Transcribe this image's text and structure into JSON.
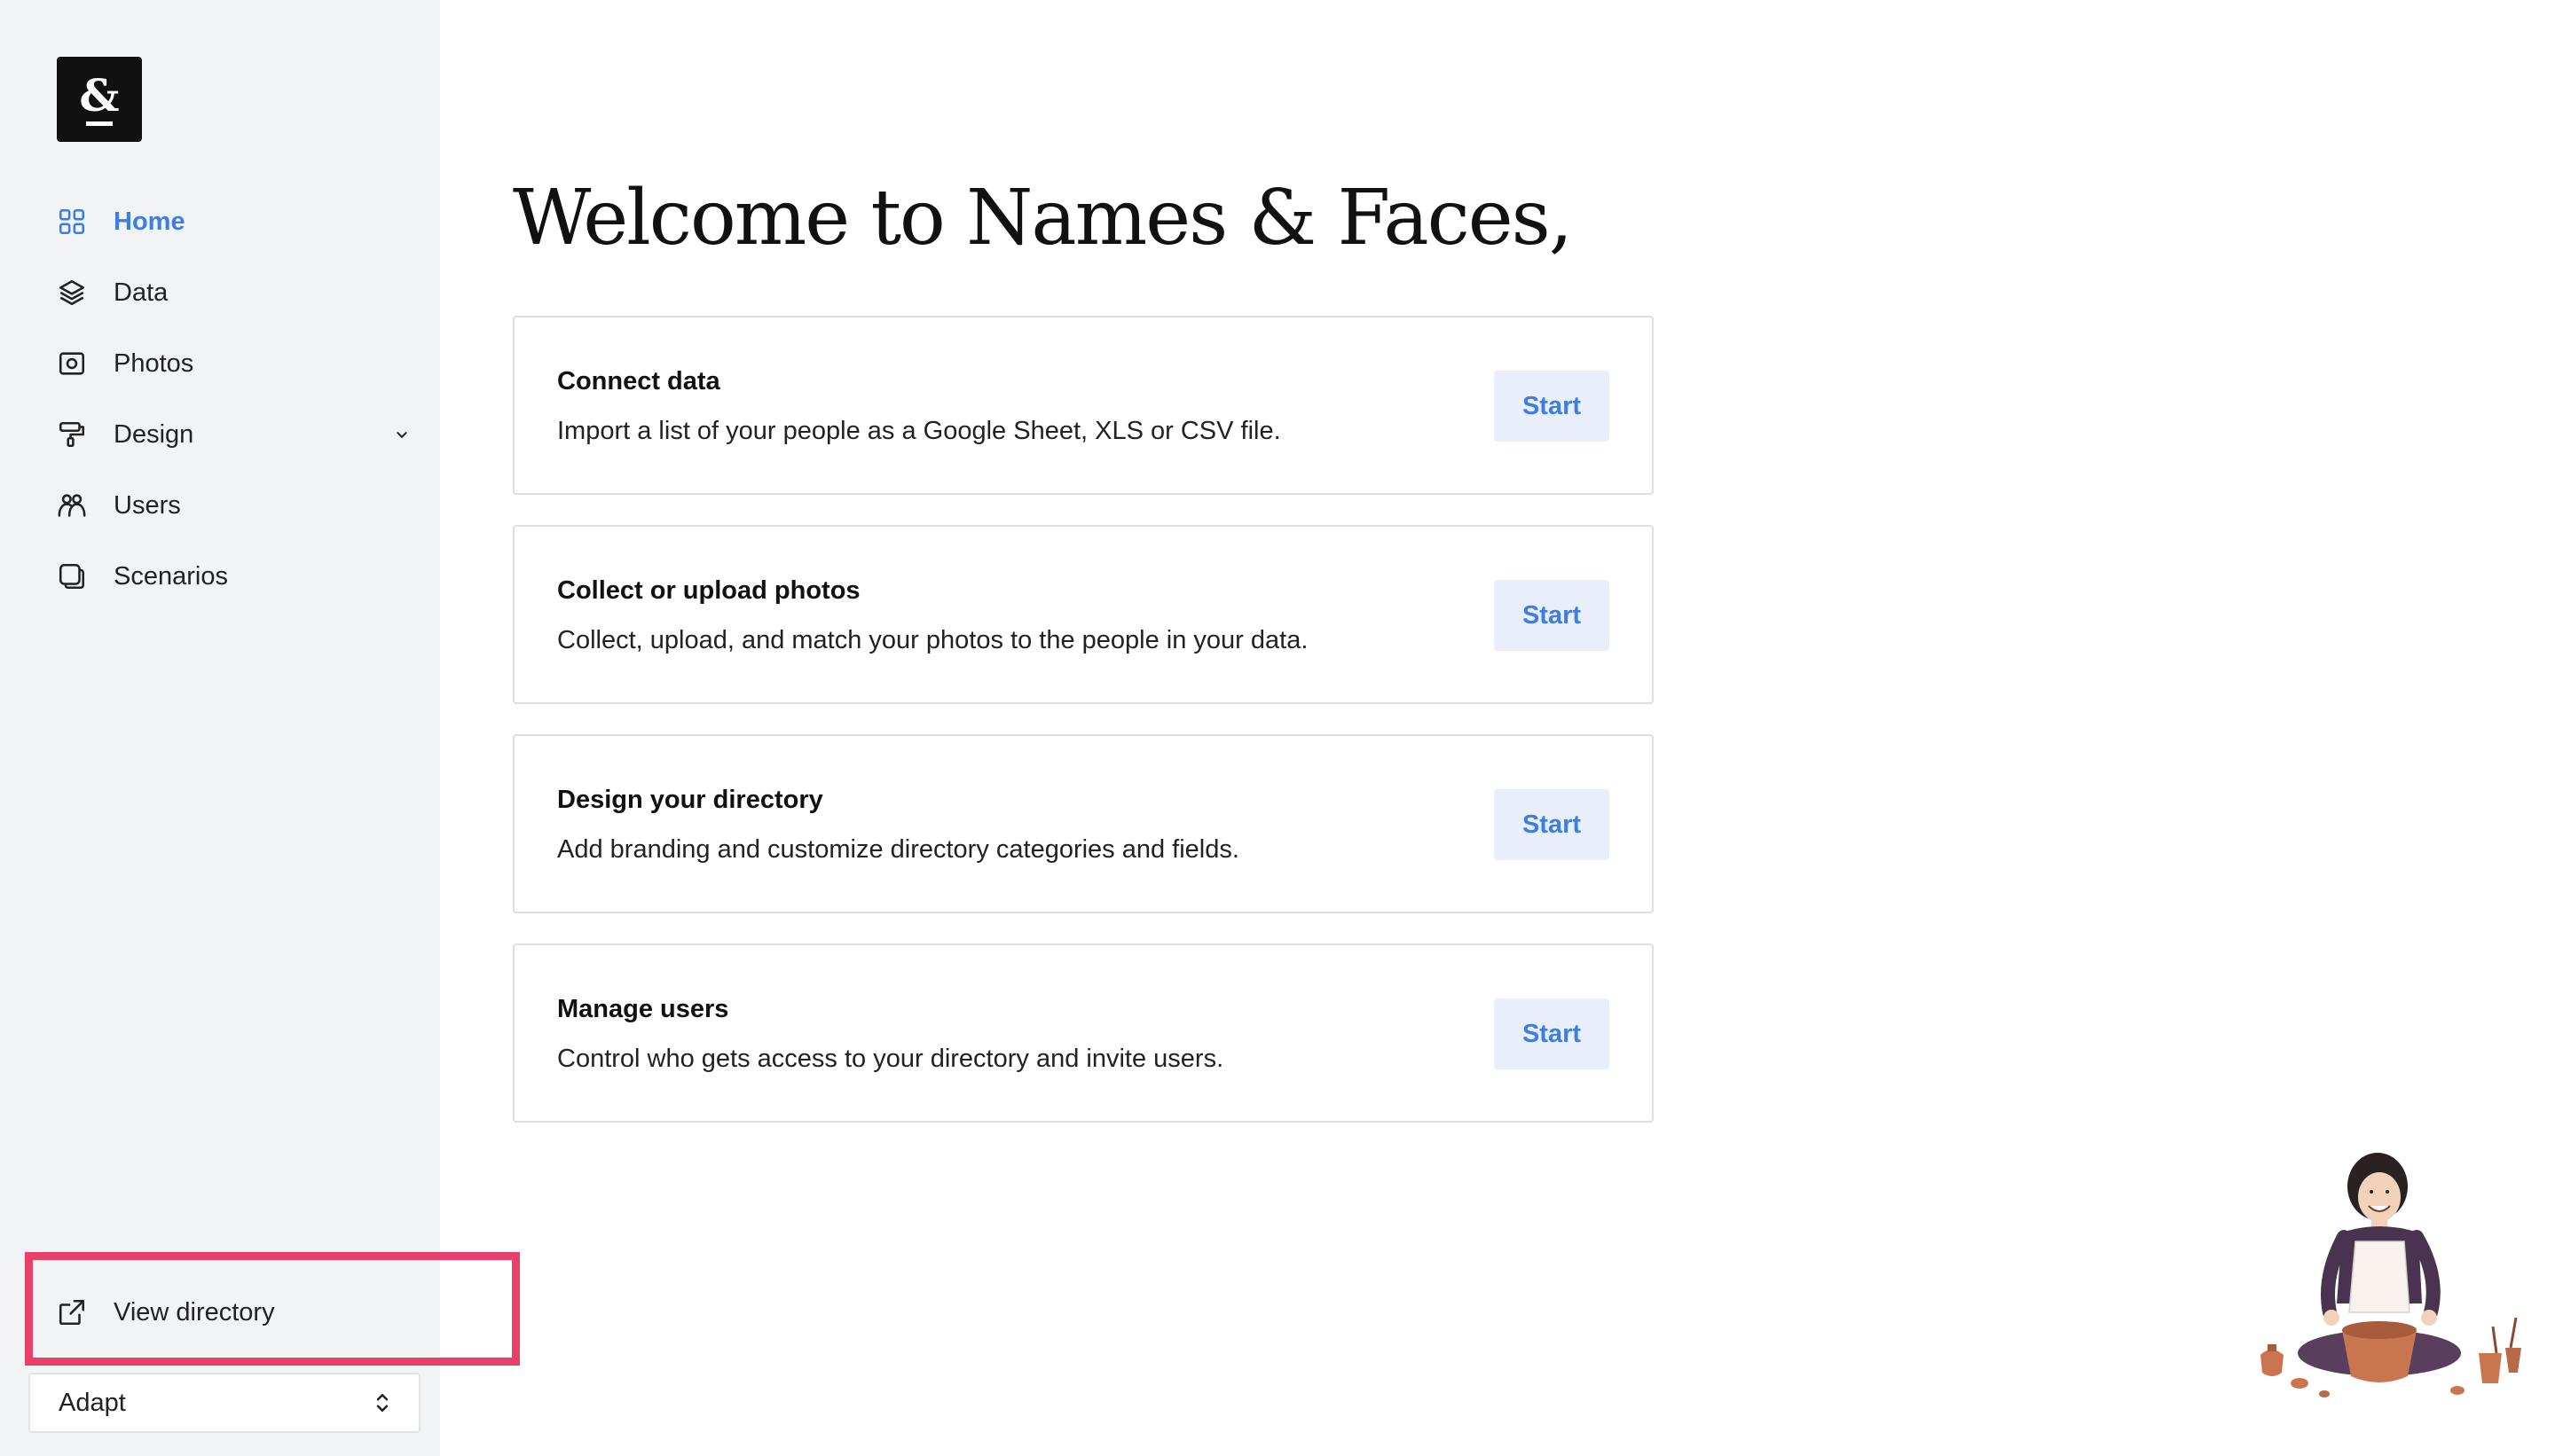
{
  "brand": {
    "logo_text": "&"
  },
  "sidebar": {
    "items": [
      {
        "label": "Home",
        "icon": "grid-icon",
        "active": true
      },
      {
        "label": "Data",
        "icon": "layers-icon",
        "active": false
      },
      {
        "label": "Photos",
        "icon": "photo-icon",
        "active": false
      },
      {
        "label": "Design",
        "icon": "paint-roller-icon",
        "active": false,
        "has_dropdown": true
      },
      {
        "label": "Users",
        "icon": "users-icon",
        "active": false
      },
      {
        "label": "Scenarios",
        "icon": "scenarios-icon",
        "active": false
      }
    ],
    "view_directory": {
      "label": "View directory",
      "icon": "external-link-icon"
    },
    "org_select": {
      "value": "Adapt"
    }
  },
  "main": {
    "title": "Welcome to Names & Faces,",
    "cards": [
      {
        "title": "Connect data",
        "description": "Import a list of your people as a Google Sheet, XLS or CSV file.",
        "button": "Start"
      },
      {
        "title": "Collect or upload photos",
        "description": "Collect, upload, and match your photos to the people in your data.",
        "button": "Start"
      },
      {
        "title": "Design your directory",
        "description": "Add branding and customize directory categories and fields.",
        "button": "Start"
      },
      {
        "title": "Manage users",
        "description": "Control who gets access to your directory and invite users.",
        "button": "Start"
      }
    ]
  },
  "colors": {
    "accent": "#3d7ee0",
    "sidebar_bg": "#f2f3f5",
    "highlight": "#e8406a",
    "button_bg": "#e8effa"
  }
}
